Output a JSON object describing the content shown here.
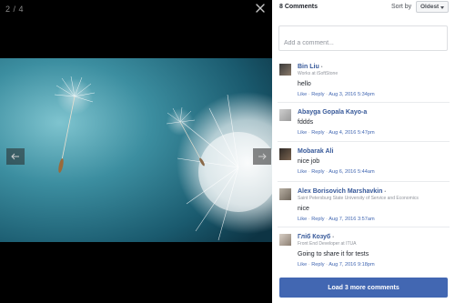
{
  "viewer": {
    "counter": "2 / 4",
    "close_icon": "close-icon",
    "prev_icon": "arrow-left-icon",
    "next_icon": "arrow-right-icon",
    "photo_subject": "dandelion seeds on teal background"
  },
  "panel": {
    "title": "8 Comments",
    "sort_label": "Sort by",
    "sort_value": "Oldest",
    "input_placeholder": "Add a comment...",
    "load_more": "Load 3 more comments"
  },
  "comments": [
    {
      "name": "Bin Liu",
      "sub": "Works at iSoftStone",
      "text": "hello",
      "like": "Like",
      "reply": "Reply",
      "time": "Aug 3, 2016 5:34pm"
    },
    {
      "name": "Abayga Gopala Kayo-a",
      "sub": "",
      "text": "fddds",
      "like": "Like",
      "reply": "Reply",
      "time": "Aug 4, 2016 5:47pm"
    },
    {
      "name": "Mobarak Ali",
      "sub": "",
      "text": "nice job",
      "like": "Like",
      "reply": "Reply",
      "time": "Aug 6, 2016 5:44am"
    },
    {
      "name": "Alex Borisovich Marshavkin",
      "sub": "Saint Petersburg State University of Service and Economics",
      "text": "nice",
      "like": "Like",
      "reply": "Reply",
      "time": "Aug 7, 2016 3:57am"
    },
    {
      "name": "Гліб Козуб",
      "sub": "Front End Developer at ITUA",
      "text": "Going to share it for tests",
      "like": "Like",
      "reply": "Reply",
      "time": "Aug 7, 2016 9:18pm"
    }
  ],
  "colors": {
    "link": "#365899",
    "button": "#4267b2",
    "viewer_bg": "#000000"
  }
}
